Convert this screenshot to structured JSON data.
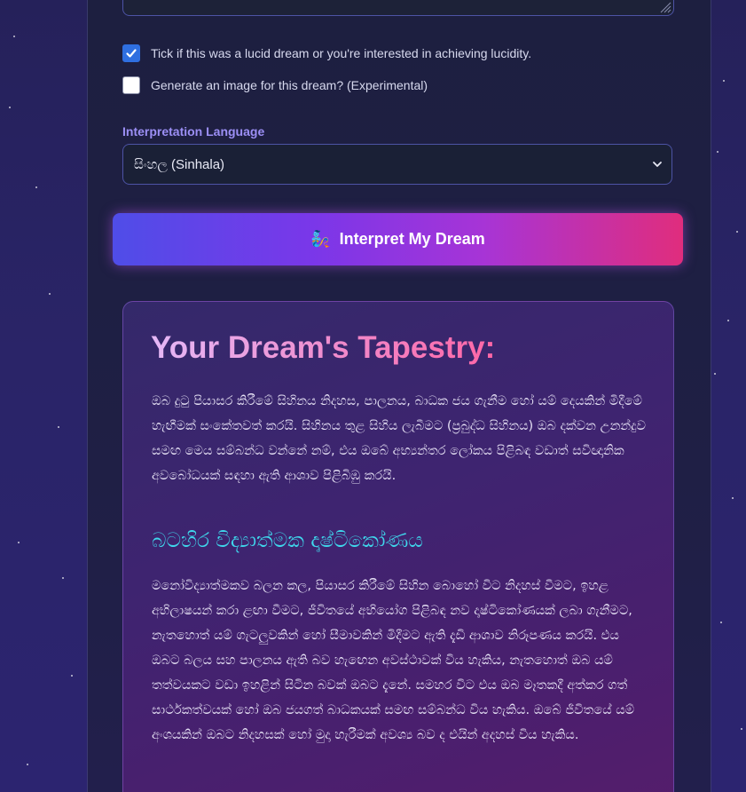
{
  "form": {
    "lucid_checkbox": {
      "label": "Tick if this was a lucid dream or you're interested in achieving lucidity.",
      "checked": true
    },
    "image_checkbox": {
      "label": "Generate an image for this dream? (Experimental)",
      "checked": false
    },
    "language": {
      "label": "Interpretation Language",
      "selected": "සිංහල (Sinhala)"
    },
    "submit": {
      "icon": "🧞",
      "label": "Interpret My Dream"
    }
  },
  "result": {
    "title": "Your Dream's Tapestry:",
    "intro": "ඔබ දුටු පියාසර කිරීමේ සිහිනය නිදහස, පාලනය, බාධක ජය ගැනීම හෝ යම් දෙයකින් මිදීමේ හැඟීමක් සංකේතවත් කරයි. සිහිනය තුළ සිහිය ලැබීමට (ප්‍රබුද්ධ සිහිනය) ඔබ දක්වන උනන්දුව සමඟ මෙය සම්බන්ධ වන්නේ නම්, එය ඔබේ අභ්‍යන්තර ලෝකය පිළිබඳ වඩාත් සවිඥානික අවබෝධයක් සඳහා ඇති ආශාව පිළිබිඹු කරයි.",
    "section_title": "බටහිර විද්‍යාත්මක දෘෂ්ටිකෝණය",
    "section_body": "මනෝවිද්‍යාත්මකව බලන කල, පියාසර කිරීමේ සිහින බොහෝ විට නිදහස් වීමට, ඉහළ අභිලාෂයන් කරා ළඟා වීමට, ජීවිතයේ අභියෝග පිළිබඳ නව දෘෂ්ටිකෝණයක් ලබා ගැනීමට, නැතහොත් යම් ගැටලුවකින් හෝ සීමාවකින් මිදීමට ඇති දැඩි ආශාව නිරූපණය කරයි. එය ඔබට බලය සහ පාලනය ඇති බව හැඟෙන අවස්ථාවක් විය හැකිය, නැතහොත් ඔබ යම් තත්වයකට වඩා ඉහළින් සිටින බවක් ඔබට දැනේ. සමහර විට එය ඔබ මෑතකදී අත්කර ගත් සාර්ථකත්වයක් හෝ ඔබ ජයගත් බාධකයක් සමඟ සම්බන්ධ විය හැකිය. ඔබේ ජීවිතයේ යම් අංශයකින් ඔබට නිදහසක් හෝ මුදා හැරීමක් අවශ්‍ය බව ද එයින් අදහස් විය හැකිය."
  },
  "colors": {
    "accent_label": "#9c8ff5",
    "section_title": "#3fd7ec",
    "button_gradient": [
      "#4f4de8",
      "#a734d6",
      "#e02d7d"
    ]
  }
}
